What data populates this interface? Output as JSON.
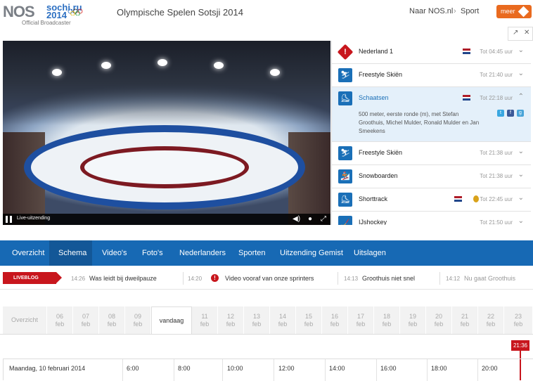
{
  "header": {
    "logo": "NOS",
    "sochi_logo_line1": "sochi.ru",
    "sochi_logo_line2": "2014",
    "broadcaster": "Official Broadcaster",
    "title": "Olympische Spelen Sotsji 2014",
    "naar": "Naar NOS.nl",
    "sport": "Sport",
    "meer": "meer"
  },
  "video": {
    "live_label": "Live-uitzending"
  },
  "events": [
    {
      "name": "Nederland 1",
      "time": "Tot 04:45 uur",
      "icon": "alert-icon",
      "flag": true
    },
    {
      "name": "Freestyle Skiën",
      "time": "Tot 21:40 uur",
      "icon": "skier-icon"
    },
    {
      "name": "Schaatsen",
      "time": "Tot 22:18 uur",
      "icon": "skater-icon",
      "flag": true,
      "active": true,
      "description": "500 meter, eerste ronde (m), met Stefan Groothuis, Michel Mulder, Ronald Mulder en Jan Smeekens"
    },
    {
      "name": "Freestyle Skiën",
      "time": "Tot 21:38 uur",
      "icon": "skier-icon"
    },
    {
      "name": "Snowboarden",
      "time": "Tot 21:38 uur",
      "icon": "snowboard-icon"
    },
    {
      "name": "Shorttrack",
      "time": "Tot 22:45 uur",
      "icon": "shorttrack-icon",
      "flag": true,
      "medal": true
    },
    {
      "name": "IJshockey",
      "time": "Tot 21:50 uur",
      "icon": "hockey-icon"
    }
  ],
  "nav": [
    "Overzicht",
    "Schema",
    "Video's",
    "Foto's",
    "Nederlanders",
    "Sporten",
    "Uitzending Gemist",
    "Uitslagen"
  ],
  "nav_active": "Schema",
  "liveblog": {
    "badge": "LIVEBLOG",
    "items": [
      {
        "time": "14:26",
        "text": "Was leidt bij dweilpauze"
      },
      {
        "time": "14:20",
        "text": "Video vooraf van onze sprinters"
      },
      {
        "time": "14:13",
        "text": "Groothuis niet snel"
      },
      {
        "time": "14:12",
        "text": "Nu gaat Groothuis"
      }
    ]
  },
  "dates": {
    "overview": "Overzicht",
    "days": [
      {
        "day": "06",
        "month": "feb"
      },
      {
        "day": "07",
        "month": "feb"
      },
      {
        "day": "08",
        "month": "feb"
      },
      {
        "day": "09",
        "month": "feb"
      },
      {
        "today": "vandaag"
      },
      {
        "day": "11",
        "month": "feb"
      },
      {
        "day": "12",
        "month": "feb"
      },
      {
        "day": "13",
        "month": "feb"
      },
      {
        "day": "14",
        "month": "feb"
      },
      {
        "day": "15",
        "month": "feb"
      },
      {
        "day": "16",
        "month": "feb"
      },
      {
        "day": "17",
        "month": "feb"
      },
      {
        "day": "18",
        "month": "feb"
      },
      {
        "day": "19",
        "month": "feb"
      },
      {
        "day": "20",
        "month": "feb"
      },
      {
        "day": "21",
        "month": "feb"
      },
      {
        "day": "22",
        "month": "feb"
      },
      {
        "day": "23",
        "month": "feb"
      }
    ]
  },
  "timeline": {
    "now": "21:36",
    "date": "Maandag, 10 februari 2014",
    "hours": [
      "6:00",
      "8:00",
      "10:00",
      "12:00",
      "14:00",
      "16:00",
      "18:00",
      "20:00"
    ]
  },
  "colors": {
    "nos_blue": "#1769b4",
    "nos_red": "#c8161d",
    "meer_orange": "#e96a1f"
  }
}
